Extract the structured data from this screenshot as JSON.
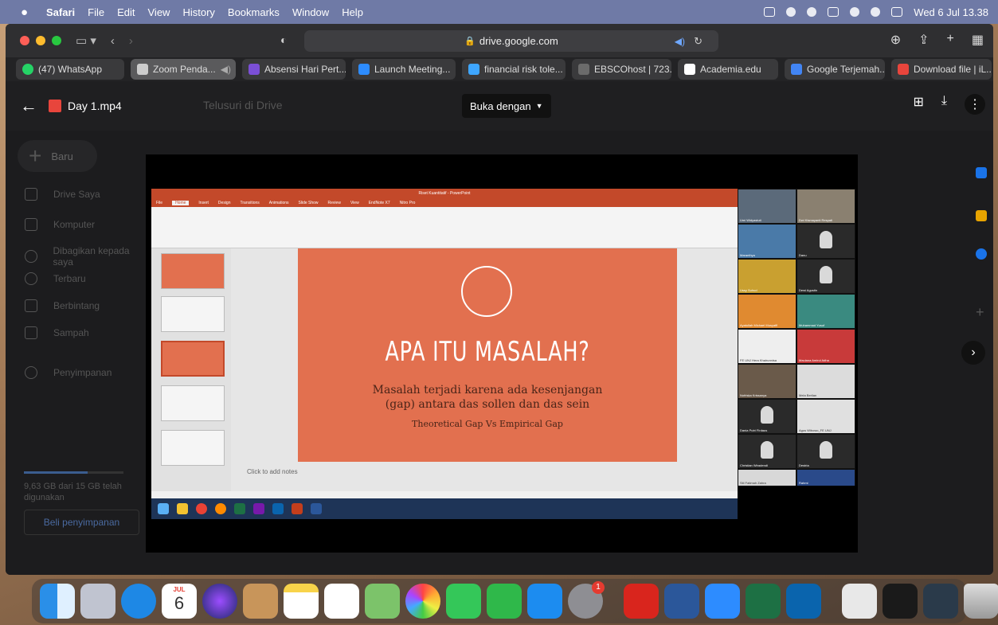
{
  "menubar": {
    "app": "Safari",
    "items": [
      "File",
      "Edit",
      "View",
      "History",
      "Bookmarks",
      "Window",
      "Help"
    ],
    "clock": "Wed 6 Jul  13.38"
  },
  "safari": {
    "address": "drive.google.com",
    "tabs": [
      {
        "label": "(47) WhatsApp",
        "color": "#25d366"
      },
      {
        "label": "Zoom Penda...",
        "color": "#8a8a8a"
      },
      {
        "label": "Absensi Hari Pert...",
        "color": "#7b4fd6"
      },
      {
        "label": "Launch Meeting...",
        "color": "#2d8cff"
      },
      {
        "label": "financial risk tole...",
        "color": "#3ea6ff"
      },
      {
        "label": "EBSCOhost | 723...",
        "color": "#6b6b6b"
      },
      {
        "label": "Academia.edu",
        "color": "#ffffff"
      },
      {
        "label": "Google Terjemah...",
        "color": "#4285f4"
      },
      {
        "label": "Download file | iL...",
        "color": "#e8453c"
      }
    ]
  },
  "drive": {
    "file_name": "Day 1.mp4",
    "search_placeholder": "Telusuri di Drive",
    "open_with": "Buka dengan",
    "new_label": "Baru",
    "nav": [
      "Drive Saya",
      "Komputer",
      "Dibagikan kepada saya",
      "Terbaru",
      "Berbintang",
      "Sampah",
      "Penyimpanan"
    ],
    "storage_text": "9,63 GB dari 15 GB telah digunakan",
    "storage_fraction": 0.64,
    "buy_storage": "Beli penyimpanan"
  },
  "presentation": {
    "window_title": "Riset Kuantitatif - PowerPoint",
    "tabs": [
      "File",
      "Home",
      "Insert",
      "Design",
      "Transitions",
      "Animations",
      "Slide Show",
      "Review",
      "View",
      "EndNote X7",
      "Nitro Pro"
    ],
    "slide_title": "APA ITU MASALAH?",
    "slide_line1": "Masalah terjadi karena ada kesenjangan",
    "slide_line2": "(gap) antara das sollen dan das sein",
    "slide_line3": "Theoretical Gap Vs Empirical Gap",
    "notes_placeholder": "Click to add notes",
    "accent": "#e2704f"
  },
  "participants": [
    "Umi Widyastuti",
    "Dwi Kismayanti Respati",
    "Maranthya",
    "Danu",
    "Ussy Suhud",
    "Dewi Agustin",
    "Ayatullah Michael Musyaffi",
    "Muhammad Yusuf",
    "FE UNJ Hera Khairunnisa",
    "Maulana Amirul Adha",
    "Nofriska Krissanya",
    "Mela Berlian",
    "Dania Putri Firdaus",
    "Agus Wibowo_FE UNJ",
    "Christian Wiradendi",
    "Destria",
    "Siti Fatimah Zahra",
    "Rahmi"
  ],
  "dock": {
    "calendar_month": "JUL",
    "calendar_day": "6",
    "settings_badge": "1"
  }
}
